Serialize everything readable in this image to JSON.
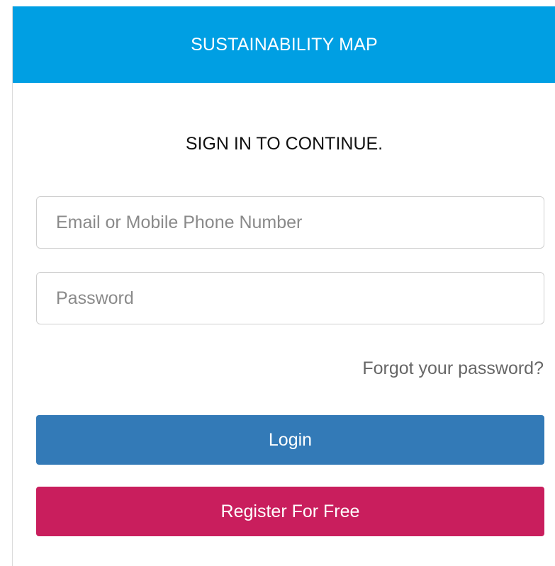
{
  "header": {
    "title": "SUSTAINABILITY MAP",
    "background_color": "#009fe3"
  },
  "form": {
    "subtitle": "SIGN IN TO CONTINUE.",
    "email": {
      "placeholder": "Email or Mobile Phone Number",
      "value": ""
    },
    "password": {
      "placeholder": "Password",
      "value": ""
    },
    "forgot_password_label": "Forgot your password?",
    "login_label": "Login",
    "login_color": "#337ab7",
    "register_label": "Register For Free",
    "register_color": "#c91e5d"
  }
}
